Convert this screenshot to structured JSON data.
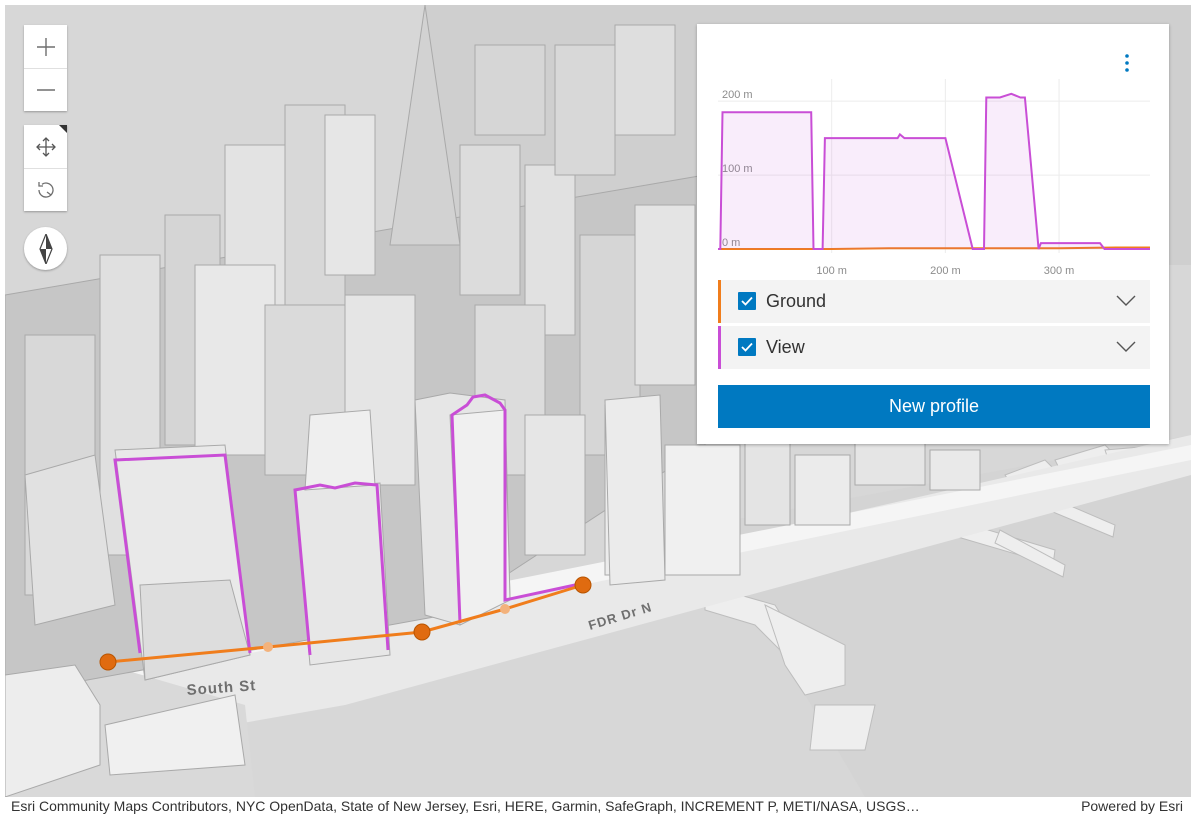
{
  "map": {
    "street_labels": [
      "South St",
      "FDR Dr N"
    ]
  },
  "controls": {
    "zoom_in": "zoom-in-icon",
    "zoom_out": "zoom-out-icon",
    "pan": "pan-icon",
    "rotate": "rotate-icon",
    "compass": "compass-icon"
  },
  "profile_panel": {
    "menu_icon": "more-vertical-icon",
    "rows": [
      {
        "label": "Ground",
        "checked": true,
        "color": "#f07d1c"
      },
      {
        "label": "View",
        "checked": true,
        "color": "#c94ed6"
      }
    ],
    "new_profile_label": "New profile",
    "accent_color": "#0079c1"
  },
  "chart_data": {
    "type": "line",
    "title": "",
    "x_ticks": [
      "100 m",
      "200 m",
      "300 m"
    ],
    "y_ticks": [
      "200 m",
      "100 m",
      "0 m"
    ],
    "xlim": [
      0,
      380
    ],
    "ylim": [
      0,
      230
    ],
    "grid": true,
    "series": [
      {
        "name": "Ground",
        "color": "#f07d1c",
        "x": [
          0,
          50,
          100,
          150,
          200,
          250,
          300,
          350,
          380
        ],
        "y": [
          0,
          0,
          0,
          1,
          1,
          1,
          1,
          2,
          2
        ]
      },
      {
        "name": "View",
        "color": "#c94ed6",
        "x": [
          0,
          2,
          4,
          82,
          84,
          90,
          92,
          94,
          158,
          160,
          164,
          200,
          224,
          234,
          236,
          248,
          258,
          266,
          270,
          282,
          284,
          336,
          340,
          380
        ],
        "y": [
          0,
          0,
          185,
          185,
          0,
          0,
          0,
          150,
          150,
          155,
          150,
          150,
          0,
          0,
          205,
          205,
          210,
          205,
          205,
          0,
          8,
          8,
          0,
          0
        ]
      }
    ]
  },
  "attribution": {
    "text": "Esri Community Maps Contributors, NYC OpenData, State of New Jersey, Esri, HERE, Garmin, SafeGraph, INCREMENT P, METI/NASA, USGS…",
    "powered_by": "Powered by Esri"
  }
}
